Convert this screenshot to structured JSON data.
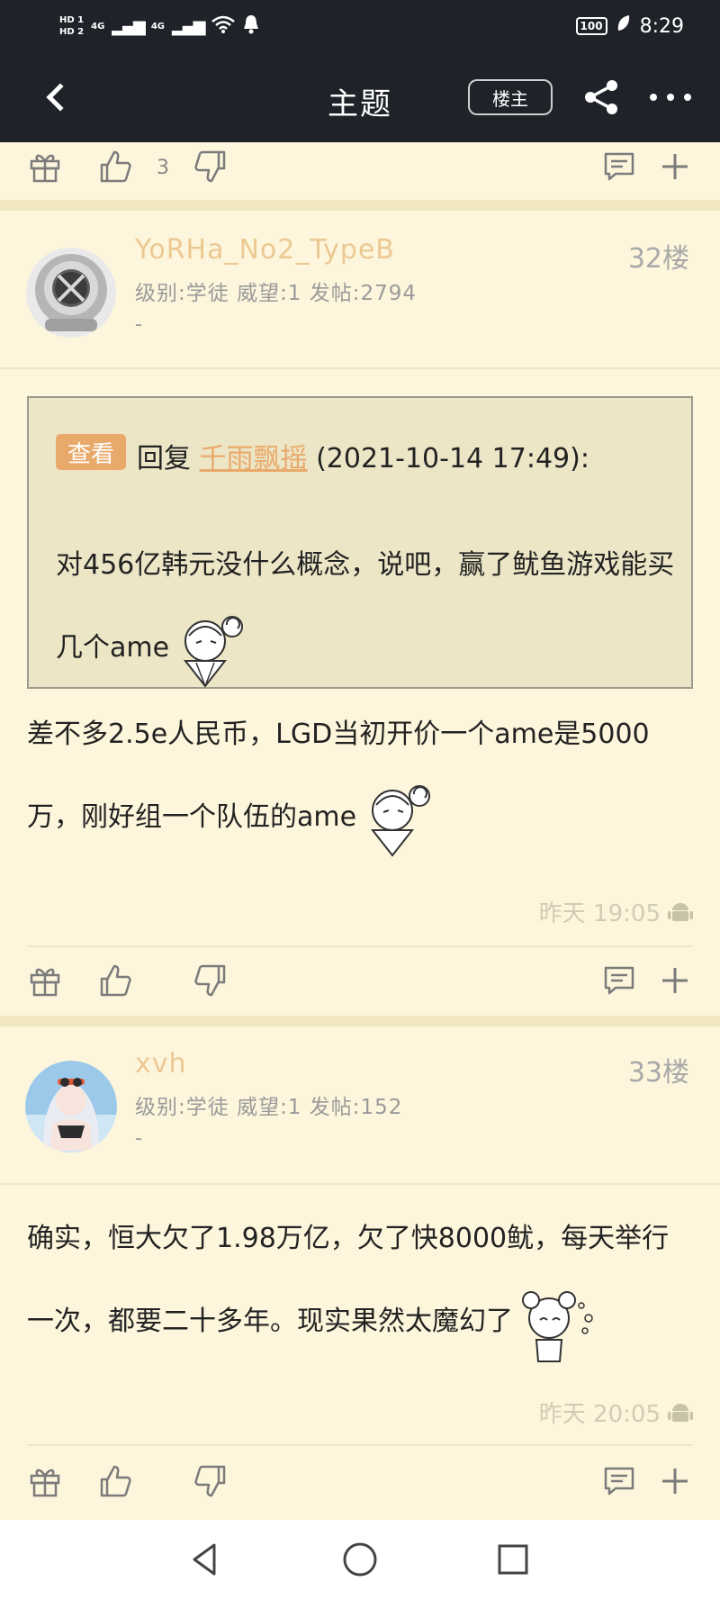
{
  "status_bar": {
    "hd1": "HD 1",
    "hd2": "HD 2",
    "net1": "4G",
    "net2": "4G",
    "battery": "100",
    "time": "8:29"
  },
  "app_bar": {
    "title": "主题",
    "owner_label": "楼主",
    "back_icon": "chevron-left-icon",
    "share_icon": "share-icon",
    "more_icon": "more-icon"
  },
  "top_actions": {
    "like_count": "3"
  },
  "posts": [
    {
      "username": "YoRHa_No2_TypeB",
      "level": "级别:学徒",
      "prestige": "威望:1",
      "posts": "发帖:2794",
      "signature": "-",
      "floor": "32楼",
      "quote": {
        "view_label": "查看",
        "reply_prefix": "回复",
        "author": "千雨飘摇",
        "date": "(2021-10-14 17:49):",
        "text": "对456亿韩元没什么概念，说吧，赢了鱿鱼游戏能买几个ame"
      },
      "body": "差不多2.5e人民币，LGD当初开价一个ame是5000万，刚好组一个队伍的ame",
      "time": "昨天 19:05"
    },
    {
      "username": "xvh",
      "level": "级别:学徒",
      "prestige": "威望:1",
      "posts": "发帖:152",
      "signature": "-",
      "floor": "33楼",
      "body": "确实，恒大欠了1.98万亿，欠了快8000鱿，每天举行一次，都要二十多年。现实果然太魔幻了",
      "time": "昨天 20:05"
    }
  ],
  "colors": {
    "background": "#fdf6dc",
    "appbar": "#1f2329",
    "username": "#ecc893",
    "quote_bg": "#ece6c7",
    "accent": "#e9a96a"
  }
}
